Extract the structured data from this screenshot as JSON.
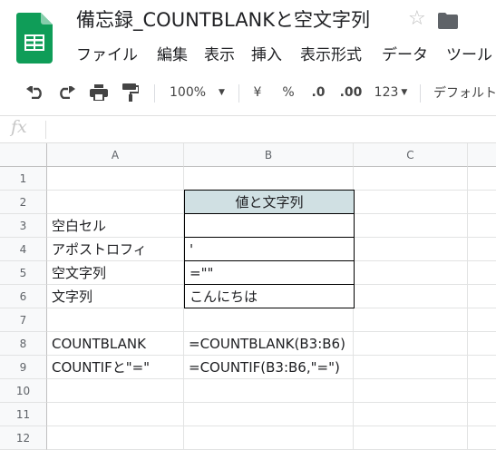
{
  "doc": {
    "title": "備忘録_COUNTBLANKと空文字列"
  },
  "menu": [
    "ファイル",
    "編集",
    "表示",
    "挿入",
    "表示形式",
    "データ",
    "ツール"
  ],
  "toolbar": {
    "zoom": "100%",
    "currency": "¥",
    "percent": "%",
    "dec_decrease": ".0",
    "dec_increase": ".00",
    "number_format": "123",
    "font": "デフォルト"
  },
  "formula_bar": {
    "fx": "fx"
  },
  "columns": [
    "A",
    "B",
    "C"
  ],
  "rows": [
    "1",
    "2",
    "3",
    "4",
    "5",
    "6",
    "7",
    "8",
    "9",
    "10",
    "11",
    "12"
  ],
  "cells": {
    "B2": "値と文字列",
    "A3": "空白セル",
    "A4": "アポストロフィ",
    "B4": "'",
    "A5": "空文字列",
    "B5": "=\"\"",
    "A6": "文字列",
    "B6": "こんにちは",
    "A8": "COUNTBLANK",
    "B8": "=COUNTBLANK(B3:B6)",
    "A9": "COUNTIFと\"=\"",
    "B9": "=COUNTIF(B3:B6,\"=\")"
  },
  "colors": {
    "header_fill": "#d0e0e3",
    "sheets_green": "#0f9d58"
  }
}
